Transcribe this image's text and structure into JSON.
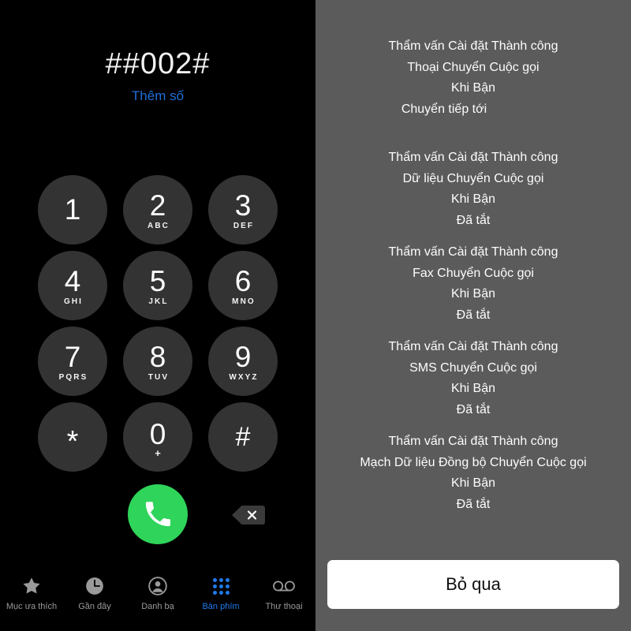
{
  "dialer": {
    "dialed_number": "##002#",
    "add_number_label": "Thêm số",
    "keys": [
      {
        "digit": "1",
        "letters": ""
      },
      {
        "digit": "2",
        "letters": "ABC"
      },
      {
        "digit": "3",
        "letters": "DEF"
      },
      {
        "digit": "4",
        "letters": "GHI"
      },
      {
        "digit": "5",
        "letters": "JKL"
      },
      {
        "digit": "6",
        "letters": "MNO"
      },
      {
        "digit": "7",
        "letters": "PQRS"
      },
      {
        "digit": "8",
        "letters": "TUV"
      },
      {
        "digit": "9",
        "letters": "WXYZ"
      },
      {
        "digit": "*",
        "letters": ""
      },
      {
        "digit": "0",
        "letters": "+"
      },
      {
        "digit": "#",
        "letters": ""
      }
    ],
    "call_button_icon": "phone-icon",
    "delete_button_icon": "backspace-delete-icon",
    "colors": {
      "call_green": "#2fd45a",
      "key_fill": "#333333",
      "link_blue": "#1f6fd8",
      "tab_active_blue": "#1f7bef",
      "tab_inactive_gray": "#9a9a9a",
      "panel_black": "#000000"
    }
  },
  "tabbar": {
    "tabs": [
      {
        "label": "Mục ưa thích",
        "icon": "star-icon",
        "active": false
      },
      {
        "label": "Gần đây",
        "icon": "clock-icon",
        "active": false
      },
      {
        "label": "Danh bạ",
        "icon": "person-circle-icon",
        "active": false
      },
      {
        "label": "Bàn phím",
        "icon": "keypad-dots-icon",
        "active": true
      },
      {
        "label": "Thư thoại",
        "icon": "voicemail-icon",
        "active": false
      }
    ]
  },
  "ussd": {
    "background_color": "#5b5b5b",
    "blocks": [
      {
        "lines": [
          "Thẩm vấn Cài đặt Thành công",
          "Thoại Chuyển Cuộc gọi",
          "Khi Bận",
          "Chuyển tiếp tới"
        ]
      },
      {
        "lines": [
          "Thẩm vấn Cài đặt Thành công",
          "Dữ liệu Chuyển Cuộc gọi",
          "Khi Bận",
          "Đã tắt"
        ]
      },
      {
        "lines": [
          "Thẩm vấn Cài đặt Thành công",
          "Fax Chuyển Cuộc gọi",
          "Khi Bận",
          "Đã tắt"
        ]
      },
      {
        "lines": [
          "Thẩm vấn Cài đặt Thành công",
          "SMS Chuyển Cuộc gọi",
          "Khi Bận",
          "Đã tắt"
        ]
      },
      {
        "lines": [
          "Thẩm vấn Cài đặt Thành công",
          "Mạch Dữ liệu Đồng bộ Chuyển Cuộc gọi",
          "Khi Bận",
          "Đã tắt"
        ]
      }
    ],
    "dismiss_label": "Bỏ qua"
  }
}
